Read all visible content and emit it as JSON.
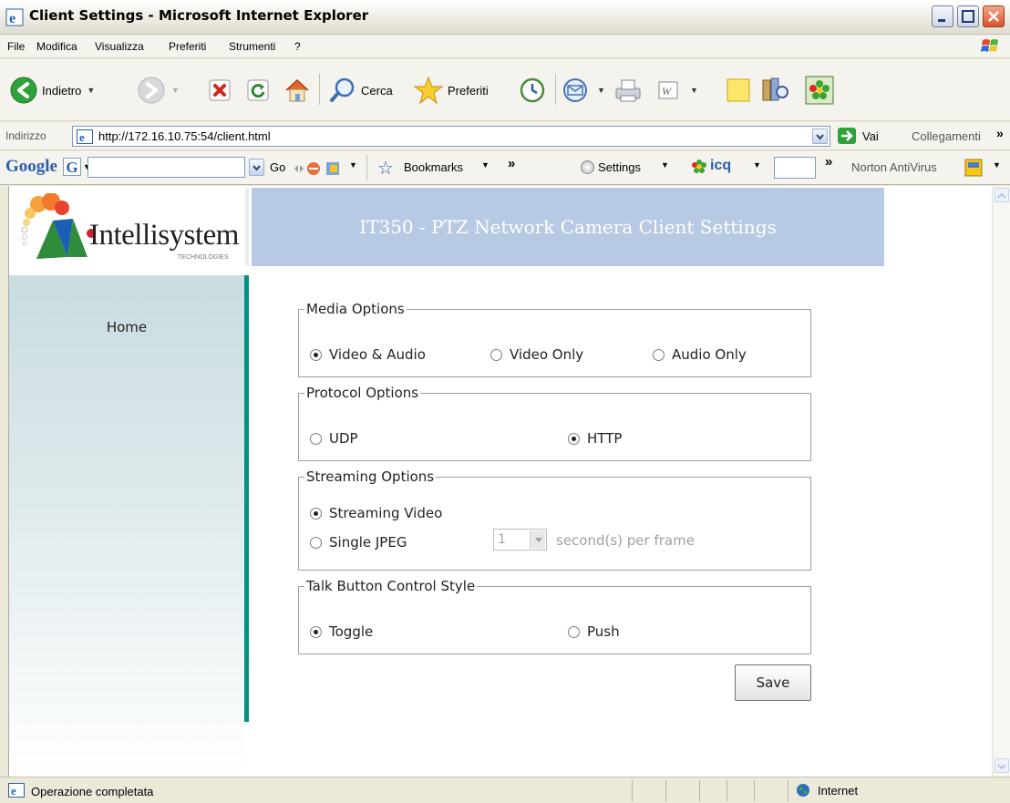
{
  "window": {
    "title": "Client Settings - Microsoft Internet Explorer"
  },
  "menu": [
    "File",
    "Modifica",
    "Visualizza",
    "Preferiti",
    "Strumenti",
    "?"
  ],
  "toolbar": {
    "back_label": "Indietro",
    "search_label": "Cerca",
    "favorites_label": "Preferiti"
  },
  "address": {
    "label": "Indirizzo",
    "url": "http://172.16.10.75:54/client.html",
    "go_label": "Vai",
    "links_label": "Collegamenti"
  },
  "googlebar": {
    "logo": "Google",
    "go_label": "Go",
    "bookmarks_label": "Bookmarks",
    "settings_label": "Settings",
    "icq_label": "icq",
    "norton_label": "Norton AntiVirus"
  },
  "page": {
    "brand": "Intellisystem",
    "brand_sub": "TECHNOLOGIES",
    "header_title": "IT350 - PTZ Network Camera Client Settings",
    "nav_home": "Home",
    "media": {
      "legend": "Media Options",
      "options": [
        "Video & Audio",
        "Video Only",
        "Audio Only"
      ],
      "selected": "Video & Audio"
    },
    "protocol": {
      "legend": "Protocol Options",
      "options": [
        "UDP",
        "HTTP"
      ],
      "selected": "HTTP"
    },
    "streaming": {
      "legend": "Streaming Options",
      "options": [
        "Streaming Video",
        "Single JPEG"
      ],
      "selected": "Streaming Video",
      "frame_value": "1",
      "frame_suffix": "second(s) per frame"
    },
    "talk": {
      "legend": "Talk Button Control Style",
      "options": [
        "Toggle",
        "Push"
      ],
      "selected": "Toggle"
    },
    "save_label": "Save"
  },
  "status": {
    "text": "Operazione completata",
    "zone": "Internet"
  },
  "colors": {
    "header_bg": "#b8c9e4",
    "accent_teal": "#009385"
  }
}
